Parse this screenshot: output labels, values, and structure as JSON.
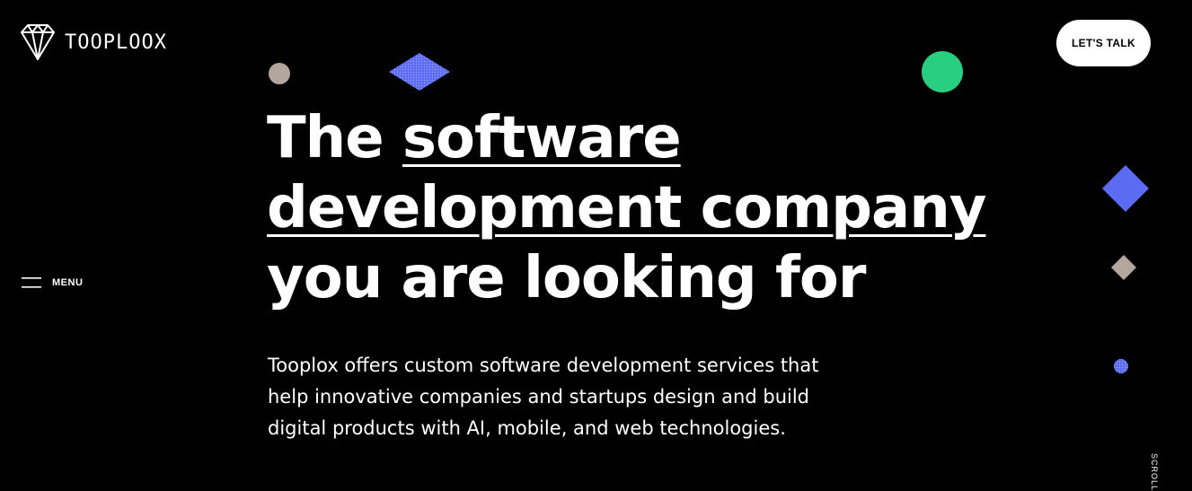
{
  "brand": {
    "name": "TOOPLOOX",
    "logo_icon": "diamond-logo-icon"
  },
  "header": {
    "cta_label": "LET'S TALK"
  },
  "nav": {
    "menu_label": "MENU",
    "menu_icon": "hamburger-icon"
  },
  "hero": {
    "line1_plain": "The ",
    "line1_underlined": "software",
    "line2_underlined": "development company",
    "line3": "you are looking for",
    "description": "Tooplox offers custom software development services that help innovative companies and startups design and build digital products with AI, mobile, and web technologies."
  },
  "scroll": {
    "label": "SCROLL"
  },
  "colors": {
    "background": "#000000",
    "text": "#ffffff",
    "accent_blue": "#5b6cf2",
    "accent_green": "#27cf7e",
    "accent_taupe": "#b3a69d"
  }
}
